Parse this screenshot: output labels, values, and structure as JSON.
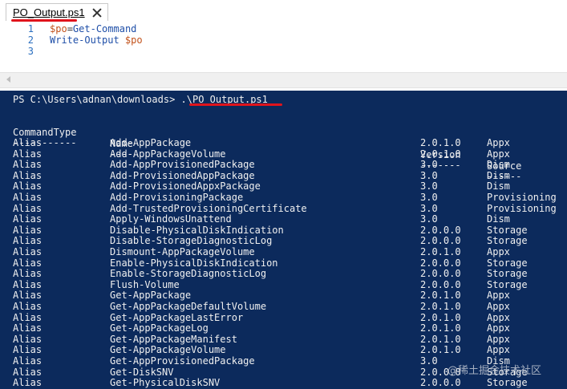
{
  "editor": {
    "tab": {
      "label": "PO_Output.ps1"
    },
    "lines": [
      {
        "number": "1",
        "var": "$po",
        "op": "=",
        "cmd": "Get-Command",
        "arg": ""
      },
      {
        "number": "2",
        "var": "",
        "op": "",
        "cmd": "Write-Output",
        "arg": " $po"
      },
      {
        "number": "3",
        "var": "",
        "op": "",
        "cmd": "",
        "arg": ""
      }
    ]
  },
  "console": {
    "prompt": "PS C:\\Users\\adnan\\downloads> ",
    "command": ".\\PO_Output.ps1",
    "headers": [
      "CommandType",
      "Name",
      "Version",
      "Source"
    ],
    "separators": [
      "-----------",
      "----",
      "-------",
      "------"
    ],
    "rows": [
      [
        "Alias",
        "Add-AppPackage",
        "2.0.1.0",
        "Appx"
      ],
      [
        "Alias",
        "Add-AppPackageVolume",
        "2.0.1.0",
        "Appx"
      ],
      [
        "Alias",
        "Add-AppProvisionedPackage",
        "3.0",
        "Dism"
      ],
      [
        "Alias",
        "Add-ProvisionedAppPackage",
        "3.0",
        "Dism"
      ],
      [
        "Alias",
        "Add-ProvisionedAppxPackage",
        "3.0",
        "Dism"
      ],
      [
        "Alias",
        "Add-ProvisioningPackage",
        "3.0",
        "Provisioning"
      ],
      [
        "Alias",
        "Add-TrustedProvisioningCertificate",
        "3.0",
        "Provisioning"
      ],
      [
        "Alias",
        "Apply-WindowsUnattend",
        "3.0",
        "Dism"
      ],
      [
        "Alias",
        "Disable-PhysicalDiskIndication",
        "2.0.0.0",
        "Storage"
      ],
      [
        "Alias",
        "Disable-StorageDiagnosticLog",
        "2.0.0.0",
        "Storage"
      ],
      [
        "Alias",
        "Dismount-AppPackageVolume",
        "2.0.1.0",
        "Appx"
      ],
      [
        "Alias",
        "Enable-PhysicalDiskIndication",
        "2.0.0.0",
        "Storage"
      ],
      [
        "Alias",
        "Enable-StorageDiagnosticLog",
        "2.0.0.0",
        "Storage"
      ],
      [
        "Alias",
        "Flush-Volume",
        "2.0.0.0",
        "Storage"
      ],
      [
        "Alias",
        "Get-AppPackage",
        "2.0.1.0",
        "Appx"
      ],
      [
        "Alias",
        "Get-AppPackageDefaultVolume",
        "2.0.1.0",
        "Appx"
      ],
      [
        "Alias",
        "Get-AppPackageLastError",
        "2.0.1.0",
        "Appx"
      ],
      [
        "Alias",
        "Get-AppPackageLog",
        "2.0.1.0",
        "Appx"
      ],
      [
        "Alias",
        "Get-AppPackageManifest",
        "2.0.1.0",
        "Appx"
      ],
      [
        "Alias",
        "Get-AppPackageVolume",
        "2.0.1.0",
        "Appx"
      ],
      [
        "Alias",
        "Get-AppProvisionedPackage",
        "3.0",
        "Dism"
      ],
      [
        "Alias",
        "Get-DiskSNV",
        "2.0.0.0",
        "Storage"
      ],
      [
        "Alias",
        "Get-PhysicalDiskSNV",
        "2.0.0.0",
        "Storage"
      ]
    ]
  },
  "watermark": "@稀土掘金技术社区",
  "colors": {
    "console_bg": "#0c2a5c",
    "console_text": "#f0f0f0",
    "highlight_underline": "#e0141c",
    "line_number": "#2b6fbf",
    "variable": "#c2521b",
    "cmdlet": "#1f4fa8"
  }
}
